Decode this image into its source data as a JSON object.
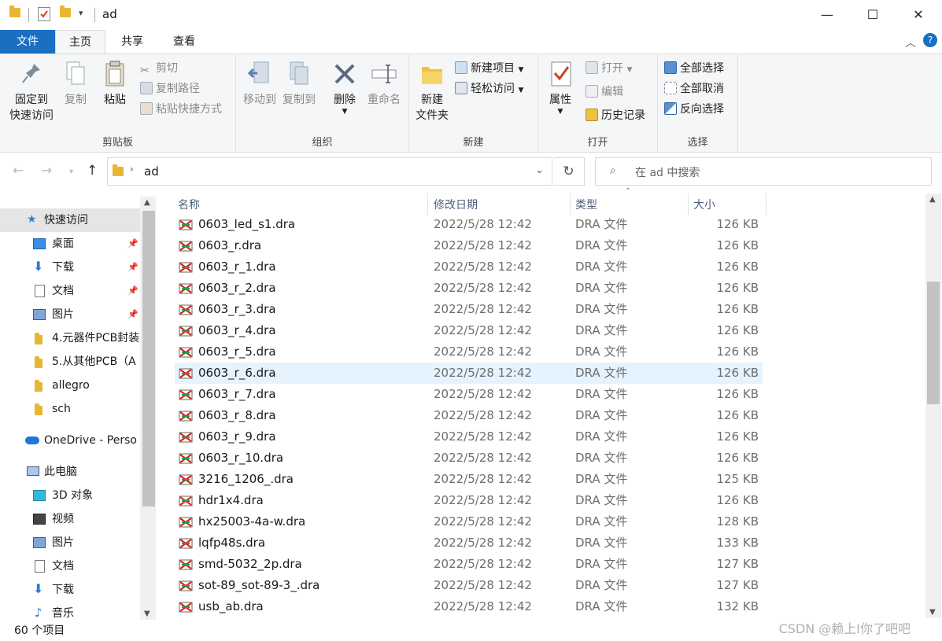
{
  "window": {
    "title": "ad",
    "controls": {
      "minimize": "—",
      "maximize": "☐",
      "close": "✕"
    }
  },
  "tabs": [
    {
      "label": "文件"
    },
    {
      "label": "主页"
    },
    {
      "label": "共享"
    },
    {
      "label": "查看"
    }
  ],
  "ribbon": {
    "clipboard": {
      "label": "剪贴板",
      "pin": "固定到",
      "pin2": "快速访问",
      "copy": "复制",
      "paste": "粘贴",
      "cut": "剪切",
      "copy_path": "复制路径",
      "paste_shortcut": "粘贴快捷方式"
    },
    "organize": {
      "label": "组织",
      "move_to": "移动到",
      "copy_to": "复制到",
      "delete": "删除",
      "rename": "重命名"
    },
    "new": {
      "label": "新建",
      "new_folder": "新建",
      "new_folder2": "文件夹",
      "new_item": "新建项目",
      "easy_access": "轻松访问"
    },
    "open": {
      "label": "打开",
      "properties": "属性",
      "open": "打开",
      "edit": "编辑",
      "history": "历史记录"
    },
    "select": {
      "label": "选择",
      "select_all": "全部选择",
      "select_none": "全部取消",
      "invert": "反向选择"
    }
  },
  "address": {
    "path": "ad",
    "search_placeholder": "在 ad 中搜索"
  },
  "nav": [
    {
      "label": "快速访问",
      "icon": "star-icon",
      "pinned": false,
      "selected": true
    },
    {
      "label": "桌面",
      "icon": "desktop-icon",
      "pinned": true
    },
    {
      "label": "下载",
      "icon": "download-icon",
      "pinned": true
    },
    {
      "label": "文档",
      "icon": "document-icon",
      "pinned": true
    },
    {
      "label": "图片",
      "icon": "picture-icon",
      "pinned": true
    },
    {
      "label": "4.元器件PCB封装",
      "icon": "folder-icon"
    },
    {
      "label": "5.从其他PCB（A",
      "icon": "folder-icon"
    },
    {
      "label": "allegro",
      "icon": "folder-icon"
    },
    {
      "label": "sch",
      "icon": "folder-icon"
    },
    {
      "label": "OneDrive - Perso",
      "icon": "cloud-icon"
    },
    {
      "label": "此电脑",
      "icon": "computer-icon"
    },
    {
      "label": "3D 对象",
      "icon": "3d-objects-icon"
    },
    {
      "label": "视频",
      "icon": "video-icon"
    },
    {
      "label": "图片",
      "icon": "picture-icon"
    },
    {
      "label": "文档",
      "icon": "document-icon"
    },
    {
      "label": "下载",
      "icon": "download-icon"
    },
    {
      "label": "音乐",
      "icon": "music-icon"
    }
  ],
  "columns": {
    "name": "名称",
    "date": "修改日期",
    "type": "类型",
    "size": "大小"
  },
  "files": [
    {
      "name": "0603_led_s1.dra",
      "date": "2022/5/28 12:42",
      "type": "DRA 文件",
      "size": "126 KB"
    },
    {
      "name": "0603_r.dra",
      "date": "2022/5/28 12:42",
      "type": "DRA 文件",
      "size": "126 KB"
    },
    {
      "name": "0603_r_1.dra",
      "date": "2022/5/28 12:42",
      "type": "DRA 文件",
      "size": "126 KB"
    },
    {
      "name": "0603_r_2.dra",
      "date": "2022/5/28 12:42",
      "type": "DRA 文件",
      "size": "126 KB"
    },
    {
      "name": "0603_r_3.dra",
      "date": "2022/5/28 12:42",
      "type": "DRA 文件",
      "size": "126 KB"
    },
    {
      "name": "0603_r_4.dra",
      "date": "2022/5/28 12:42",
      "type": "DRA 文件",
      "size": "126 KB"
    },
    {
      "name": "0603_r_5.dra",
      "date": "2022/5/28 12:42",
      "type": "DRA 文件",
      "size": "126 KB"
    },
    {
      "name": "0603_r_6.dra",
      "date": "2022/5/28 12:42",
      "type": "DRA 文件",
      "size": "126 KB",
      "selected": true
    },
    {
      "name": "0603_r_7.dra",
      "date": "2022/5/28 12:42",
      "type": "DRA 文件",
      "size": "126 KB"
    },
    {
      "name": "0603_r_8.dra",
      "date": "2022/5/28 12:42",
      "type": "DRA 文件",
      "size": "126 KB"
    },
    {
      "name": "0603_r_9.dra",
      "date": "2022/5/28 12:42",
      "type": "DRA 文件",
      "size": "126 KB"
    },
    {
      "name": "0603_r_10.dra",
      "date": "2022/5/28 12:42",
      "type": "DRA 文件",
      "size": "126 KB"
    },
    {
      "name": "3216_1206_.dra",
      "date": "2022/5/28 12:42",
      "type": "DRA 文件",
      "size": "125 KB"
    },
    {
      "name": "hdr1x4.dra",
      "date": "2022/5/28 12:42",
      "type": "DRA 文件",
      "size": "126 KB"
    },
    {
      "name": "hx25003-4a-w.dra",
      "date": "2022/5/28 12:42",
      "type": "DRA 文件",
      "size": "128 KB"
    },
    {
      "name": "lqfp48s.dra",
      "date": "2022/5/28 12:42",
      "type": "DRA 文件",
      "size": "133 KB"
    },
    {
      "name": "smd-5032_2p.dra",
      "date": "2022/5/28 12:42",
      "type": "DRA 文件",
      "size": "127 KB"
    },
    {
      "name": "sot-89_sot-89-3_.dra",
      "date": "2022/5/28 12:42",
      "type": "DRA 文件",
      "size": "127 KB"
    },
    {
      "name": "usb_ab.dra",
      "date": "2022/5/28 12:42",
      "type": "DRA 文件",
      "size": "132 KB"
    }
  ],
  "status": {
    "count": "60 个项目"
  },
  "watermark": "CSDN @赖上I你了吧吧",
  "colors": {
    "accent": "#1b6fc2",
    "selection": "#e5f3ff",
    "ribbon_bg": "#f5f6f7"
  }
}
